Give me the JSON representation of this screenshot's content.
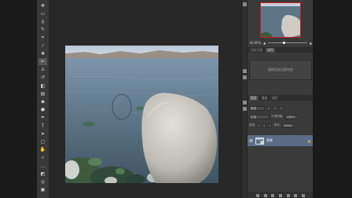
{
  "toolbar": {
    "tools": [
      {
        "name": "move-tool-icon",
        "glyph": "✥",
        "active": false
      },
      {
        "name": "marquee-tool-icon",
        "glyph": "▭",
        "active": false
      },
      {
        "name": "lasso-tool-icon",
        "glyph": "ϙ",
        "active": false
      },
      {
        "name": "quick-select-tool-icon",
        "glyph": "✎",
        "active": false
      },
      {
        "name": "crop-tool-icon",
        "glyph": "⌗",
        "active": false
      },
      {
        "name": "eyedropper-tool-icon",
        "glyph": "⁄",
        "active": false
      },
      {
        "name": "healing-brush-tool-icon",
        "glyph": "✚",
        "active": false
      },
      {
        "name": "brush-tool-icon",
        "glyph": "✏",
        "active": true
      },
      {
        "name": "clone-stamp-tool-icon",
        "glyph": "♙",
        "active": false
      },
      {
        "name": "history-brush-tool-icon",
        "glyph": "↺",
        "active": false
      },
      {
        "name": "eraser-tool-icon",
        "glyph": "◧",
        "active": false
      },
      {
        "name": "gradient-tool-icon",
        "glyph": "▤",
        "active": false
      },
      {
        "name": "blur-tool-icon",
        "glyph": "◆",
        "active": false
      },
      {
        "name": "dodge-tool-icon",
        "glyph": "●",
        "active": false
      },
      {
        "name": "pen-tool-icon",
        "glyph": "✒",
        "active": false
      },
      {
        "name": "type-tool-icon",
        "glyph": "T",
        "active": false
      },
      {
        "name": "path-select-tool-icon",
        "glyph": "➤",
        "active": false
      },
      {
        "name": "shape-tool-icon",
        "glyph": "▢",
        "active": false
      },
      {
        "name": "hand-tool-icon",
        "glyph": "✋",
        "active": false
      },
      {
        "name": "zoom-tool-icon",
        "glyph": "⌕",
        "active": false
      },
      {
        "name": "more-tools-icon",
        "glyph": "…",
        "active": false
      },
      {
        "name": "color-swatches-icon",
        "glyph": "◩",
        "active": false
      },
      {
        "name": "quick-mask-icon",
        "glyph": "◎",
        "active": false
      },
      {
        "name": "screen-mode-icon",
        "glyph": "▣",
        "active": false
      }
    ]
  },
  "navigator": {
    "zoom": "16.95%"
  },
  "panel_tabs_1": [
    "历史记录",
    "动作"
  ],
  "actions": {
    "empty_text": "您的历史记录为空"
  },
  "layers_tabs": [
    "图层",
    "通道",
    "路径"
  ],
  "layers_controls": {
    "kind_label": "类型",
    "blend_mode": "正常",
    "opacity_label": "不透明度:",
    "opacity_value": "100%",
    "lock_label": "锁定:",
    "fill_label": "填充:",
    "fill_value": "100%"
  },
  "layer": {
    "name": "背景",
    "visible": true,
    "locked": true
  },
  "colors": {
    "panel": "#3a3a3a",
    "selected_layer": "#5a6c86",
    "navigator_frame": "#cc2020"
  }
}
